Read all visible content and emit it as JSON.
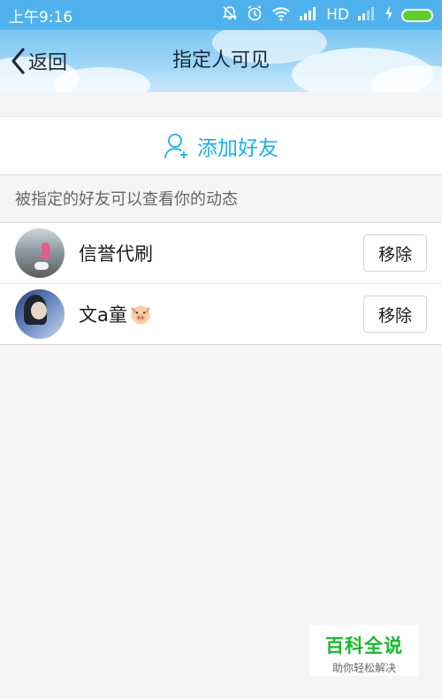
{
  "status_bar": {
    "time": "上午9:16",
    "network": "HD",
    "icons": [
      "bell-mute-icon",
      "alarm-icon",
      "wifi-icon",
      "signal-icon",
      "signal-weak-icon",
      "charging-icon",
      "battery-icon"
    ],
    "battery_color": "#5fd02b"
  },
  "header": {
    "back_label": "返回",
    "title": "指定人可见"
  },
  "add_friend": {
    "label": "添加好友",
    "icon": "add-user-icon",
    "color": "#1ab0e8"
  },
  "hint": "被指定的好友可以查看你的动态",
  "friends": [
    {
      "name": "信誉代刷",
      "action": "移除",
      "avatar": "photo-person-with-dog"
    },
    {
      "name": "文a童",
      "emoji": "pig-face",
      "action": "移除",
      "avatar": "photo-girl"
    }
  ],
  "watermark": {
    "brand": "百科全说",
    "slogan": "助你轻松解决"
  }
}
